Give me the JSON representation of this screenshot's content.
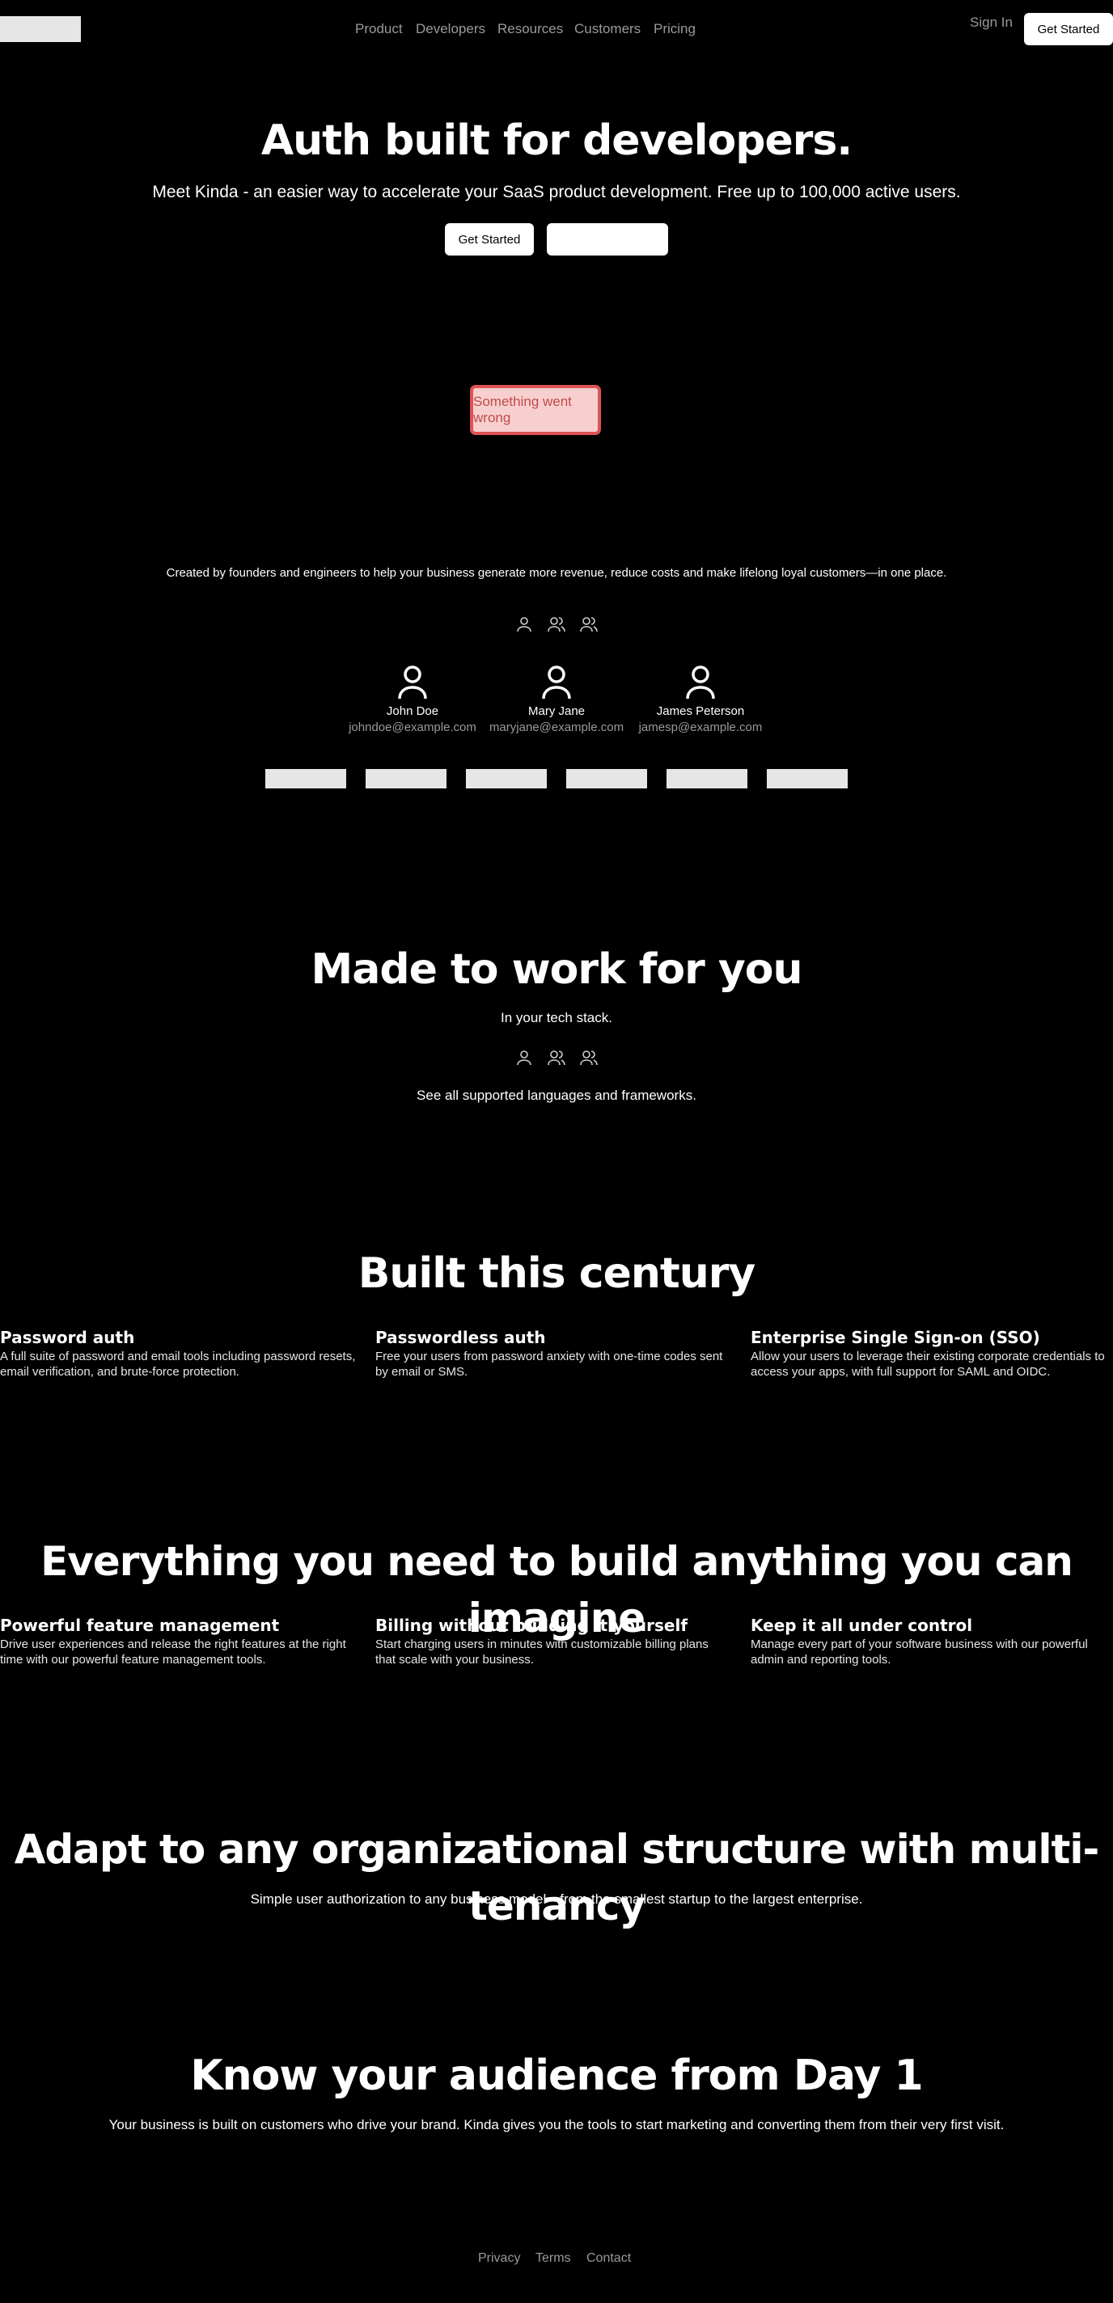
{
  "nav": {
    "links": [
      "Product",
      "Developers",
      "Resources",
      "Customers",
      "Pricing"
    ],
    "sign_in": "Sign In",
    "get_started": "Get Started"
  },
  "hero": {
    "title": "Auth built for developers.",
    "subtitle": "Meet Kinda - an easier way to accelerate your SaaS product development. Free up to 100,000 active users.",
    "primary_button": "Get Started",
    "secondary_button": ""
  },
  "error": {
    "message": "Something went wrong"
  },
  "founders": {
    "text": "Created by founders and engineers to help your business generate more revenue, reduce costs and make lifelong loyal customers—in one place.",
    "icons": [
      "user-icon",
      "users-icon",
      "users-icon"
    ],
    "users": [
      {
        "name": "John Doe",
        "email": "johndoe@example.com"
      },
      {
        "name": "Mary Jane",
        "email": "maryjane@example.com"
      },
      {
        "name": "James Peterson",
        "email": "jamesp@example.com"
      }
    ],
    "logo_count": 6
  },
  "made_to_work": {
    "title": "Made to work for you",
    "subtitle": "In your tech stack.",
    "link": "See all supported languages and frameworks."
  },
  "built_century": {
    "title": "Built this century",
    "features": [
      {
        "title": "Password auth",
        "desc": "A full suite of password and email tools including password resets, email verification, and brute-force protection."
      },
      {
        "title": "Passwordless auth",
        "desc": "Free your users from password anxiety with one-time codes sent by email or SMS."
      },
      {
        "title": "Enterprise Single Sign-on (SSO)",
        "desc": "Allow your users to leverage their existing corporate credentials to access your apps, with full support for SAML and OIDC."
      }
    ]
  },
  "everything": {
    "title": "Everything you need to build anything you can imagine",
    "features": [
      {
        "title": "Powerful feature management",
        "desc": "Drive user experiences and release the right features at the right time with our powerful feature management tools."
      },
      {
        "title": "Billing without building it yourself",
        "desc": "Start charging users in minutes with customizable billing plans that scale with your business."
      },
      {
        "title": "Keep it all under control",
        "desc": "Manage every part of your software business with our powerful admin and reporting tools."
      }
    ]
  },
  "multitenancy": {
    "title": "Adapt to any organizational structure with multi-tenancy",
    "subtitle": "Simple user authorization to any business model—from the smallest startup to the largest enterprise."
  },
  "audience": {
    "title": "Know your audience from Day 1",
    "subtitle": "Your business is built on customers who drive your brand. Kinda gives you the tools to start marketing and converting them from their very first visit."
  },
  "footer": {
    "links": [
      "Privacy",
      "Terms",
      "Contact"
    ]
  },
  "colors": {
    "background": "#000000",
    "error_bg": "#f8cfcf",
    "error_border": "#e05252",
    "error_text": "#c24b4b"
  }
}
